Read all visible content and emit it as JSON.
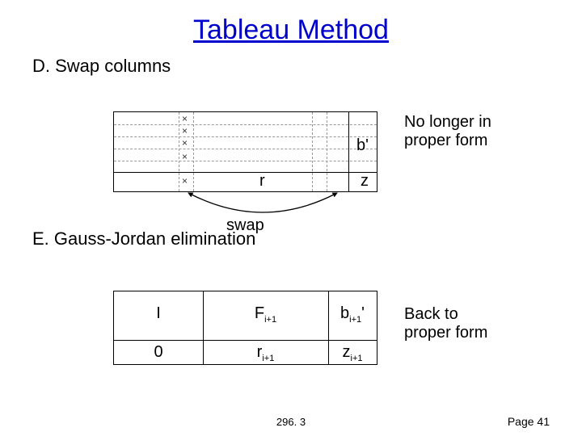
{
  "title": "Tableau Method",
  "section_d": "D.  Swap columns",
  "section_e": "E.  Gauss-Jordan elimination",
  "tab1": {
    "b_prime": "b'",
    "r": "r",
    "z": "z",
    "swap_label": "swap"
  },
  "tab2": {
    "I": "I",
    "F": "F",
    "F_sub": "i+1",
    "b": "b",
    "b_sub": "i+1",
    "b_prime_mark": "'",
    "zero": "0",
    "r": "r",
    "r_sub": "i+1",
    "zbot": "z",
    "z_sub": "i+1"
  },
  "note1_line1": "No longer in",
  "note1_line2": "proper form",
  "note2_line1": "Back to",
  "note2_line2": "proper form",
  "footer_center": "296. 3",
  "footer_right": "Page 41"
}
